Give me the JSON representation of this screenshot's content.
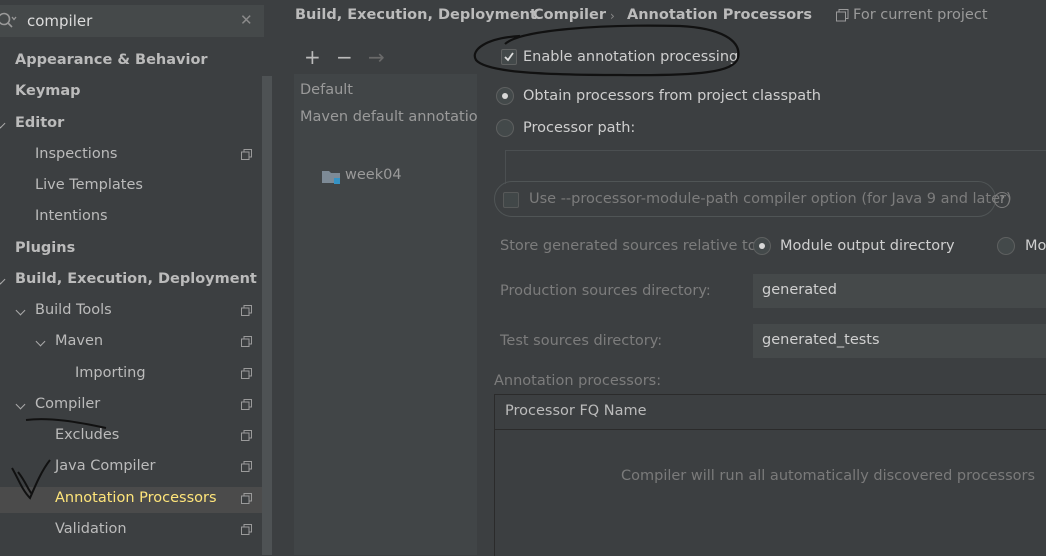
{
  "search": {
    "value": "compiler"
  },
  "sidebar": {
    "items": [
      {
        "label": "Appearance & Behavior",
        "kind": "category"
      },
      {
        "label": "Keymap",
        "kind": "category"
      },
      {
        "label": "Editor",
        "kind": "category",
        "expanded": true
      },
      {
        "label": "Inspections",
        "project_scoped": true
      },
      {
        "label": "Live Templates"
      },
      {
        "label": "Intentions"
      },
      {
        "label": "Plugins",
        "kind": "category"
      },
      {
        "label": "Build, Execution, Deployment",
        "kind": "category",
        "expanded": true
      },
      {
        "label": "Build Tools",
        "expanded": true,
        "project_scoped": true
      },
      {
        "label": "Maven",
        "expanded": true,
        "project_scoped": true
      },
      {
        "label": "Importing",
        "project_scoped": true
      },
      {
        "label": "Compiler",
        "expanded": true,
        "project_scoped": true
      },
      {
        "label": "Excludes",
        "project_scoped": true
      },
      {
        "label": "Java Compiler",
        "project_scoped": true
      },
      {
        "label": "Annotation Processors",
        "project_scoped": true,
        "selected": true
      },
      {
        "label": "Validation",
        "project_scoped": true
      }
    ]
  },
  "breadcrumb": {
    "items": [
      "Build, Execution, Deployment",
      "Compiler",
      "Annotation Processors"
    ],
    "scope": "For current project"
  },
  "profiles": {
    "toolbar": {
      "add": "+",
      "remove": "−",
      "move": "→"
    },
    "default_label": "Default",
    "maven_profile": "Maven default annotation processors profile",
    "module": "week04"
  },
  "settings": {
    "enable_label": "Enable annotation processing",
    "enable_checked": true,
    "obtain_label": "Obtain processors from project classpath",
    "processor_path_label": "Processor path:",
    "module_path_label": "Use --processor-module-path compiler option (for Java 9 and later)",
    "help_glyph": "?",
    "store_label": "Store generated sources relative to:",
    "store_option_1": "Module output directory",
    "store_option_2": "Module content root",
    "production_label": "Production sources directory:",
    "production_value": "generated",
    "test_label": "Test sources directory:",
    "test_value": "generated_tests",
    "processors_label": "Annotation processors:",
    "table_header": "Processor FQ Name",
    "table_empty": "Compiler will run all automatically discovered processors"
  },
  "colors": {
    "background": "#3c3f41",
    "selected_text": "#ffe57a",
    "text": "#bbbbbb",
    "muted_text": "#7c7c7c",
    "field_bg": "#45494a"
  }
}
